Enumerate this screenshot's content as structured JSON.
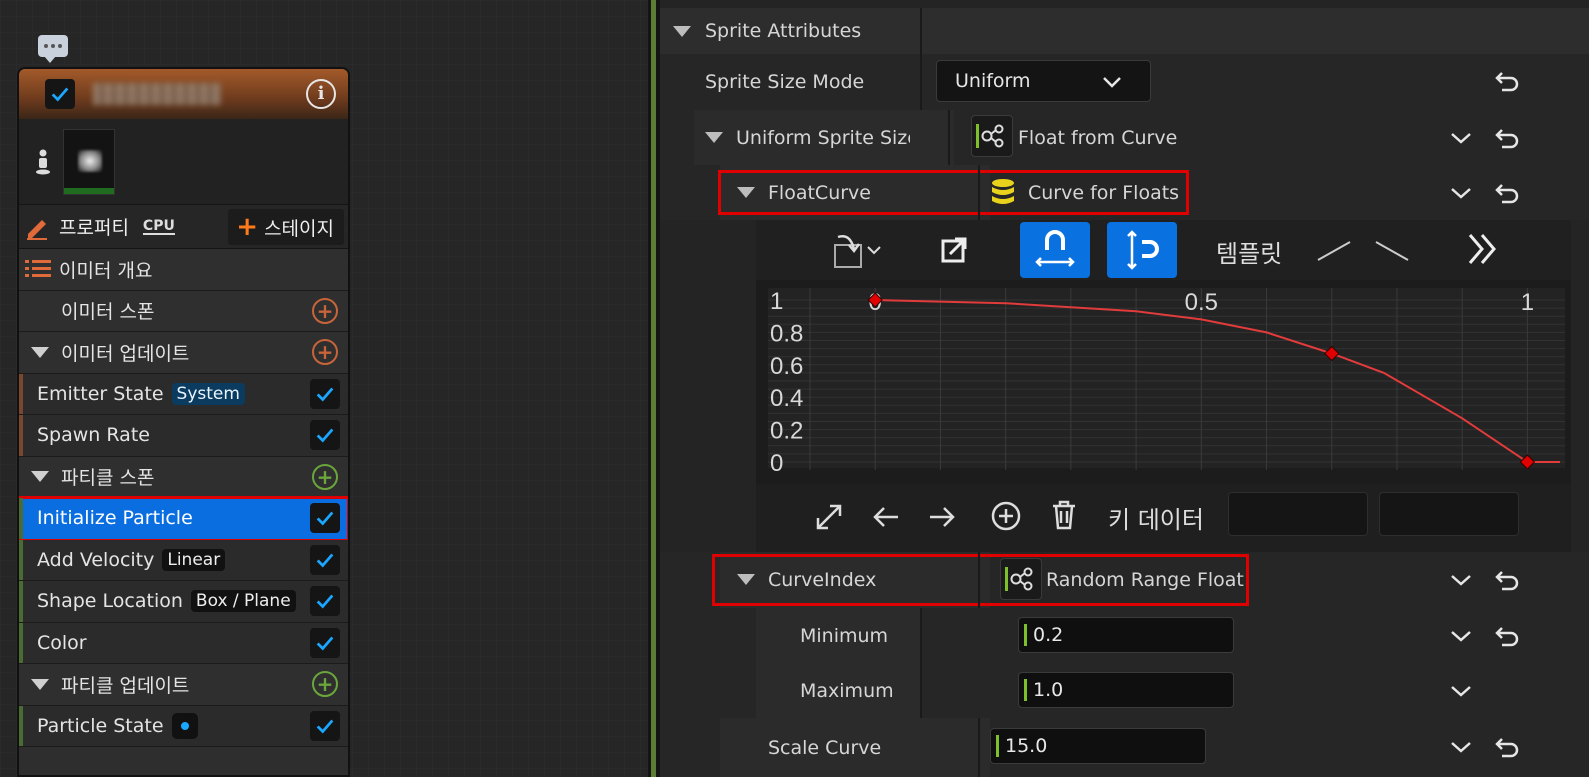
{
  "node": {
    "tabs": {
      "properties": "프로퍼티",
      "cpu": "CPU",
      "stage": "스테이지"
    },
    "rows": [
      {
        "kind": "summary",
        "label": "이미터 개요"
      },
      {
        "kind": "section",
        "label": "이미터 스폰",
        "collapsible": false,
        "add_color": "orange"
      },
      {
        "kind": "section",
        "label": "이미터 업데이트",
        "collapsible": true,
        "add_color": "orange"
      },
      {
        "kind": "module",
        "label": "Emitter State",
        "chip": "System",
        "chip_style": "sys",
        "bar": "emitter",
        "checked": true
      },
      {
        "kind": "module",
        "label": "Spawn Rate",
        "chip": "",
        "bar": "emitter",
        "checked": true
      },
      {
        "kind": "section",
        "label": "파티클 스폰",
        "collapsible": true,
        "add_color": "green"
      },
      {
        "kind": "module",
        "label": "Initialize Particle",
        "chip": "",
        "bar": "particle",
        "checked": true,
        "selected": true,
        "highlighted": true
      },
      {
        "kind": "module",
        "label": "Add Velocity",
        "chip": "Linear",
        "bar": "particle",
        "checked": true
      },
      {
        "kind": "module",
        "label": "Shape Location",
        "chip": "Box / Plane",
        "bar": "particle",
        "checked": true
      },
      {
        "kind": "module",
        "label": "Color",
        "chip": "",
        "bar": "particle",
        "checked": true
      },
      {
        "kind": "section",
        "label": "파티클 업데이트",
        "collapsible": true,
        "add_color": "green"
      },
      {
        "kind": "module",
        "label": "Particle State",
        "chip": "",
        "bar": "particle",
        "checked": true,
        "state_dot": true
      }
    ]
  },
  "details": {
    "sprite_attributes": "Sprite Attributes",
    "sprite_size_mode": {
      "label": "Sprite Size Mode",
      "value": "Uniform"
    },
    "uniform_sprite_size": {
      "label": "Uniform Sprite Size",
      "value": "Float from Curve"
    },
    "float_curve": {
      "label": "FloatCurve",
      "value": "Curve for Floats"
    },
    "curve_toolbar": {
      "template_label": "템플릿"
    },
    "key_bar": {
      "label": "키 데이터"
    },
    "curve_index": {
      "label": "CurveIndex",
      "value": "Random Range Float"
    },
    "minimum": {
      "label": "Minimum",
      "value": "0.2"
    },
    "maximum": {
      "label": "Maximum",
      "value": "1.0"
    },
    "scale_curve": {
      "label": "Scale Curve",
      "value": "15.0"
    }
  },
  "chart_data": {
    "type": "line",
    "title": "",
    "x_ticks": [
      "0",
      "0.5",
      "1"
    ],
    "y_ticks": [
      "1",
      "0.8",
      "0.6",
      "0.4",
      "0.2",
      "0"
    ],
    "xlim": [
      -0.1,
      1.05
    ],
    "ylim": [
      0,
      1
    ],
    "series": [
      {
        "x": [
          0,
          0.2,
          0.4,
          0.5,
          0.6,
          0.7,
          0.78,
          0.9,
          1.0,
          1.05
        ],
        "values": [
          1,
          0.98,
          0.93,
          0.88,
          0.8,
          0.67,
          0.55,
          0.27,
          0,
          0
        ]
      }
    ],
    "keys": [
      {
        "x": 0,
        "y": 1
      },
      {
        "x": 0.7,
        "y": 0.67
      },
      {
        "x": 1.0,
        "y": 0
      }
    ],
    "curve_color": "#e23b3b",
    "key_color": "#e00000"
  },
  "colors": {
    "accent": "#0a72e0",
    "highlight": "#e00000",
    "dynamic_input": "#7ec02a"
  }
}
